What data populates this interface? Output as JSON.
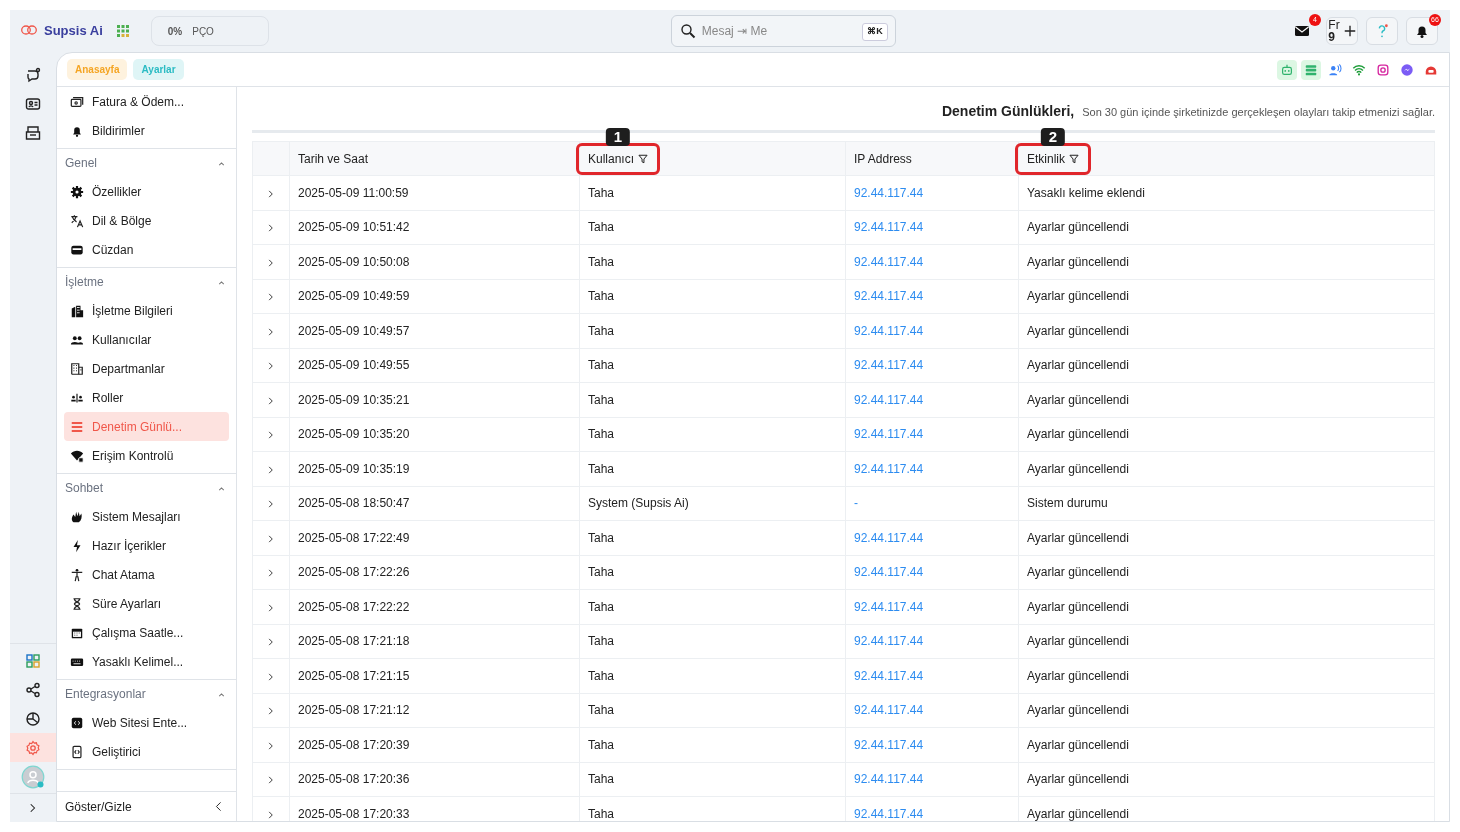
{
  "brand": {
    "name": "Supsis Ai"
  },
  "status_chip": {
    "percent": "0%",
    "label": "PÇO"
  },
  "search": {
    "placeholder": "Mesaj ⇥ Me",
    "shortcut": "⌘K"
  },
  "top_actions": [
    {
      "kind": "mail",
      "badge": "4"
    },
    {
      "kind": "language",
      "code": "Fr",
      "sub": "9"
    },
    {
      "kind": "help"
    },
    {
      "kind": "bell",
      "badge": "66"
    }
  ],
  "rail": {
    "top": [
      {
        "selected": false
      },
      {
        "selected": false
      },
      {
        "selected": false
      }
    ],
    "bottom": [
      {
        "selected": false
      },
      {
        "selected": false
      },
      {
        "selected": false
      },
      {
        "selected": true
      }
    ]
  },
  "breadcrumbs": [
    {
      "label": "Anasayfa",
      "color": "#f5a524"
    },
    {
      "label": "Ayarlar",
      "color": "#2bbcc4"
    }
  ],
  "channels": [
    {
      "highlighted": true
    },
    {
      "highlighted": true
    },
    {
      "highlighted": false
    },
    {
      "highlighted": false
    },
    {
      "highlighted": false
    },
    {
      "highlighted": false
    },
    {
      "highlighted": false
    }
  ],
  "sidebar": {
    "sections": [
      {
        "items": [
          {
            "label": "Fatura & Ödem...",
            "selected": false
          },
          {
            "label": "Bildirimler",
            "selected": false
          }
        ]
      },
      {
        "title": "Genel",
        "expanded": true,
        "items": [
          {
            "label": "Özellikler",
            "selected": false
          },
          {
            "label": "Dil & Bölge",
            "selected": false
          },
          {
            "label": "Cüzdan",
            "selected": false
          }
        ]
      },
      {
        "title": "İşletme",
        "expanded": true,
        "items": [
          {
            "label": "İşletme Bilgileri",
            "selected": false
          },
          {
            "label": "Kullanıcılar",
            "selected": false
          },
          {
            "label": "Departmanlar",
            "selected": false
          },
          {
            "label": "Roller",
            "selected": false
          },
          {
            "label": "Denetim Günlü...",
            "selected": true
          },
          {
            "label": "Erişim Kontrolü",
            "selected": false
          }
        ]
      },
      {
        "title": "Sohbet",
        "expanded": true,
        "items": [
          {
            "label": "Sistem Mesajları",
            "selected": false
          },
          {
            "label": "Hazır İçerikler",
            "selected": false
          },
          {
            "label": "Chat Atama",
            "selected": false
          },
          {
            "label": "Süre Ayarları",
            "selected": false
          },
          {
            "label": "Çalışma Saatle...",
            "selected": false
          },
          {
            "label": "Yasaklı Kelimel...",
            "selected": false
          }
        ]
      },
      {
        "title": "Entegrasyonlar",
        "expanded": true,
        "items": [
          {
            "label": "Web Sitesi Ente...",
            "selected": false
          },
          {
            "label": "Geliştirici",
            "selected": false
          }
        ]
      }
    ],
    "footer": "Göster/Gizle"
  },
  "page": {
    "title": "Denetim Günlükleri,",
    "subtitle": "Son 30 gün içinde şirketinizde gerçekleşen olayları takip etmenizi sağlar."
  },
  "table": {
    "columns": [
      {
        "label": "Tarih ve Saat",
        "filter": false
      },
      {
        "label": "Kullanıcı",
        "filter": true,
        "callout": "1"
      },
      {
        "label": "IP Address",
        "filter": false
      },
      {
        "label": "Etkinlik",
        "filter": true,
        "callout": "2"
      }
    ],
    "rows": [
      [
        "2025-05-09 11:00:59",
        "Taha",
        "92.44.117.44",
        "Yasaklı kelime eklendi"
      ],
      [
        "2025-05-09 10:51:42",
        "Taha",
        "92.44.117.44",
        "Ayarlar güncellendi"
      ],
      [
        "2025-05-09 10:50:08",
        "Taha",
        "92.44.117.44",
        "Ayarlar güncellendi"
      ],
      [
        "2025-05-09 10:49:59",
        "Taha",
        "92.44.117.44",
        "Ayarlar güncellendi"
      ],
      [
        "2025-05-09 10:49:57",
        "Taha",
        "92.44.117.44",
        "Ayarlar güncellendi"
      ],
      [
        "2025-05-09 10:49:55",
        "Taha",
        "92.44.117.44",
        "Ayarlar güncellendi"
      ],
      [
        "2025-05-09 10:35:21",
        "Taha",
        "92.44.117.44",
        "Ayarlar güncellendi"
      ],
      [
        "2025-05-09 10:35:20",
        "Taha",
        "92.44.117.44",
        "Ayarlar güncellendi"
      ],
      [
        "2025-05-09 10:35:19",
        "Taha",
        "92.44.117.44",
        "Ayarlar güncellendi"
      ],
      [
        "2025-05-08 18:50:47",
        "System (Supsis Ai)",
        "-",
        "Sistem durumu"
      ],
      [
        "2025-05-08 17:22:49",
        "Taha",
        "92.44.117.44",
        "Ayarlar güncellendi"
      ],
      [
        "2025-05-08 17:22:26",
        "Taha",
        "92.44.117.44",
        "Ayarlar güncellendi"
      ],
      [
        "2025-05-08 17:22:22",
        "Taha",
        "92.44.117.44",
        "Ayarlar güncellendi"
      ],
      [
        "2025-05-08 17:21:18",
        "Taha",
        "92.44.117.44",
        "Ayarlar güncellendi"
      ],
      [
        "2025-05-08 17:21:15",
        "Taha",
        "92.44.117.44",
        "Ayarlar güncellendi"
      ],
      [
        "2025-05-08 17:21:12",
        "Taha",
        "92.44.117.44",
        "Ayarlar güncellendi"
      ],
      [
        "2025-05-08 17:20:39",
        "Taha",
        "92.44.117.44",
        "Ayarlar güncellendi"
      ],
      [
        "2025-05-08 17:20:36",
        "Taha",
        "92.44.117.44",
        "Ayarlar güncellendi"
      ],
      [
        "2025-05-08 17:20:33",
        "Taha",
        "92.44.117.44",
        "Ayarlar güncellendi"
      ]
    ]
  }
}
